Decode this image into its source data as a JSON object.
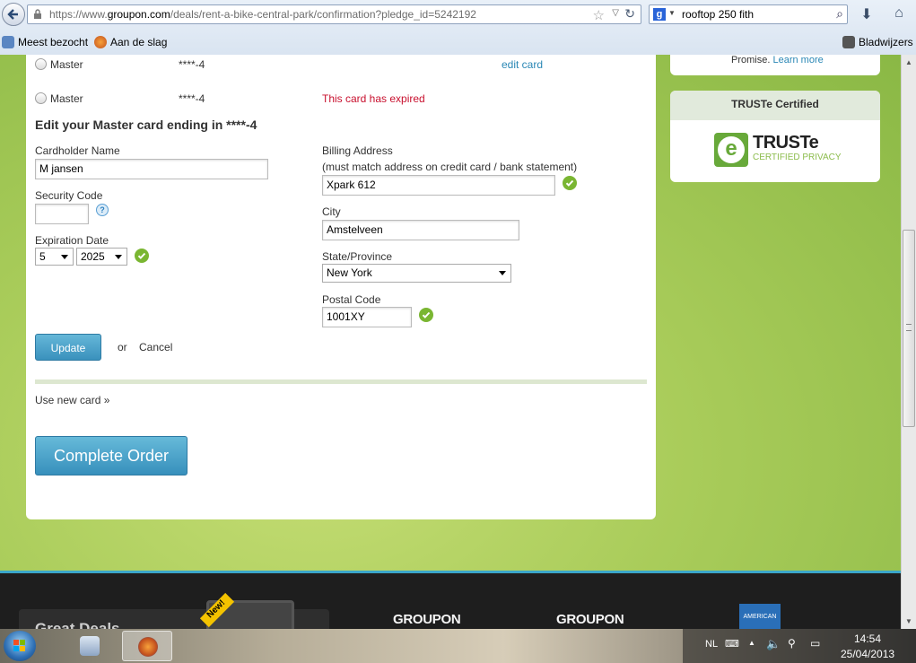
{
  "browser": {
    "url_prefix": "https://www.",
    "url_domain": "groupon.com",
    "url_path": "/deals/rent-a-bike-central-park/confirmation?pledge_id=5242192",
    "search_query": "rooftop 250 fith",
    "bookmarks": {
      "most_visited": "Meest bezocht",
      "get_started": "Aan de slag",
      "bookmarks_menu": "Bladwijzers"
    }
  },
  "cards": [
    {
      "type": "Master",
      "number": "****-4",
      "action": "edit card",
      "status": ""
    },
    {
      "type": "Master",
      "number": "****-4",
      "action": "",
      "status": "This card has expired"
    }
  ],
  "edit_form": {
    "heading": "Edit your Master card ending in ****-4",
    "cardholder_label": "Cardholder Name",
    "cardholder_value": "M jansen",
    "security_label": "Security Code",
    "security_help": "?",
    "expiration_label": "Expiration Date",
    "exp_month": "5",
    "exp_year": "2025",
    "billing_label": "Billing Address",
    "billing_note": "(must match address on credit card / bank statement)",
    "billing_value": "Xpark 612",
    "city_label": "City",
    "city_value": "Amstelveen",
    "state_label": "State/Province",
    "state_value": "New York",
    "postal_label": "Postal Code",
    "postal_value": "1001XY",
    "update_button": "Update",
    "or_text": "or",
    "cancel_link": "Cancel"
  },
  "use_new_card": "Use new card »",
  "complete_order": "Complete Order",
  "sidebar": {
    "promise_text": "Promise.",
    "learn_more": "Learn more",
    "truste_heading": "TRUSTe Certified",
    "truste_logo_word": "TRUSTe",
    "truste_logo_sub": "CERTIFIED PRIVACY"
  },
  "footer": {
    "promo_title": "Great Deals",
    "new_badge": "New!",
    "logo_1": "GROUPON",
    "logo_2": "GROUPON",
    "amex_label": "AMERICAN"
  },
  "taskbar": {
    "language": "NL",
    "time": "14:54",
    "date": "25/04/2013"
  },
  "colors": {
    "link": "#2a87b5",
    "error": "#c8102e",
    "button": "#3a91bd",
    "valid": "#7ab632",
    "page_bg": "#a9cc5a"
  }
}
